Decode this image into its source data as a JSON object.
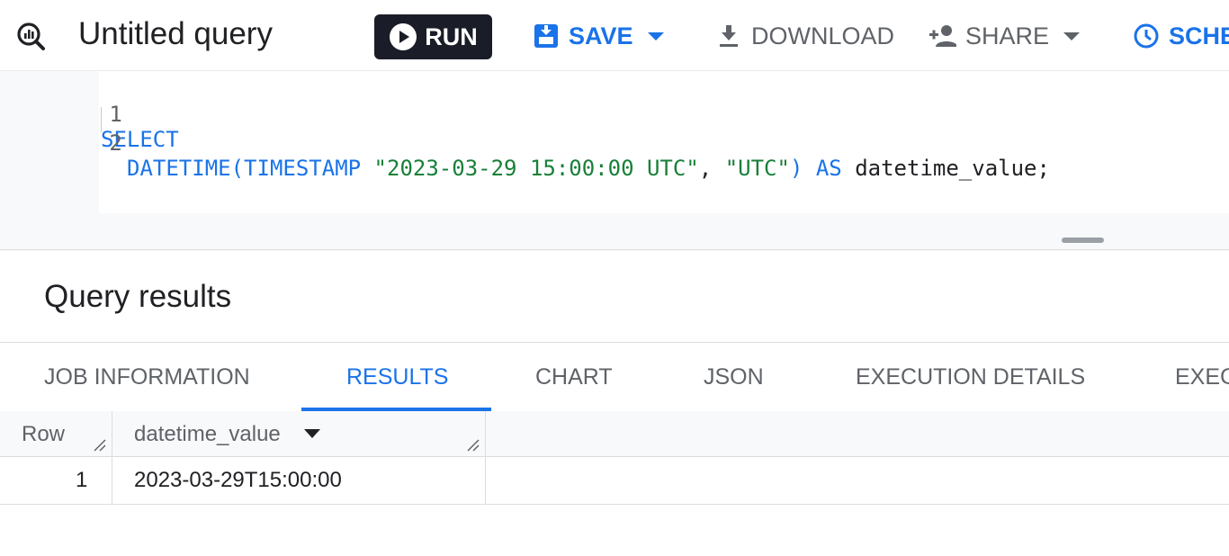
{
  "toolbar": {
    "title": "Untitled query",
    "run_label": "RUN",
    "save_label": "SAVE",
    "download_label": "DOWNLOAD",
    "share_label": "SHARE",
    "schedule_label": "SCHE",
    "icons": [
      "query-icon",
      "play-icon",
      "save-icon",
      "download-icon",
      "person-add-icon",
      "clock-icon"
    ]
  },
  "editor": {
    "lines": [
      {
        "number": "1",
        "tokens": {
          "kw": "SELECT"
        }
      },
      {
        "number": "2",
        "tokens": {
          "fn": "DATETIME(TIMESTAMP ",
          "str1": "\"2023-03-29 15:00:00 UTC\"",
          "sep": ", ",
          "str2": "\"UTC\"",
          "close": ") ",
          "as": "AS",
          "alias": " datetime_value;"
        }
      }
    ]
  },
  "results": {
    "title": "Query results",
    "tabs": [
      {
        "label": "JOB INFORMATION",
        "active": false
      },
      {
        "label": "RESULTS",
        "active": true
      },
      {
        "label": "CHART",
        "active": false
      },
      {
        "label": "JSON",
        "active": false
      },
      {
        "label": "EXECUTION DETAILS",
        "active": false
      },
      {
        "label": "EXEC",
        "active": false
      }
    ],
    "table": {
      "headers": [
        "Row",
        "datetime_value"
      ],
      "rows": [
        [
          "1",
          "2023-03-29T15:00:00"
        ]
      ]
    }
  },
  "colors": {
    "accent": "#1a73e8",
    "string": "#188038",
    "run_button": "#1a1d27"
  }
}
